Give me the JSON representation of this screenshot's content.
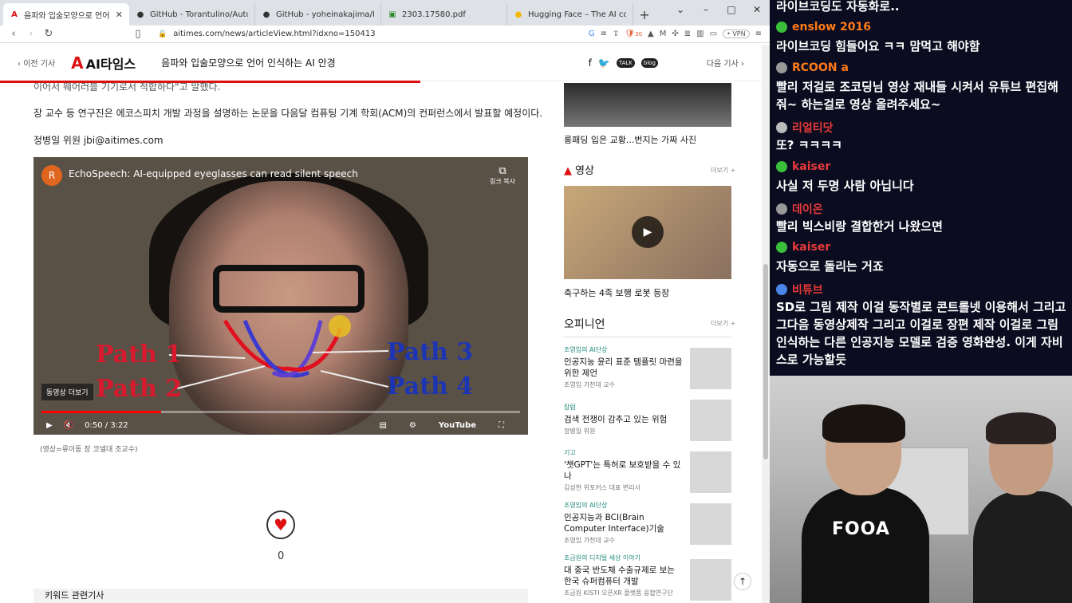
{
  "browser": {
    "tabs": [
      {
        "label": "음파와 입술모양으로 언어 인식하는 AI 안경",
        "icon": "aitimes-favicon",
        "active": true
      },
      {
        "label": "GitHub - Torantulino/Auto-GPT: An",
        "icon": "github-icon"
      },
      {
        "label": "GitHub - yoheinakajima/babyagi",
        "icon": "github-icon"
      },
      {
        "label": "2303.17580.pdf",
        "icon": "pdf-icon"
      },
      {
        "label": "Hugging Face – The AI communi",
        "icon": "huggingface-icon"
      }
    ],
    "url": "aitimes.com/news/articleView.html?idxno=150413",
    "vpn_label": "• VPN",
    "ext_badge": "30"
  },
  "site": {
    "prev_label": "이전 기사",
    "logo_text": "AI타임스",
    "headline": "음파와 입술모양으로 언어 인식하는 AI 안경",
    "next_label": "다음 기사",
    "social": {
      "talk": "TALK",
      "blog": "blog"
    }
  },
  "article": {
    "partial_line": "이어서 웨어러블 기기로서 적합하다\"고 말했다.",
    "paragraph": "장 교수 등 연구진은 에코스피치 개발 과정을 설명하는 논문을 다음달 컴퓨팅 기계 학회(ACM)의 컨퍼런스에서 발표할 예정이다.",
    "byline": "정병일 위원 jbi@aitimes.com",
    "caption": "(영상=류이동 장 코넬대 조교수)",
    "like_count": "0",
    "bottom_heading": "키워드 관련기사"
  },
  "video": {
    "avatar_letter": "R",
    "title": "EchoSpeech: AI-equipped eyeglasses can read silent speech",
    "copy_link": "링크 복사",
    "paths": [
      "Path 1",
      "Path 2",
      "Path 3",
      "Path 4"
    ],
    "more_videos": "동영상 더보기",
    "time": "0:50 / 3:22",
    "progress_fraction": 0.25,
    "brand": "YouTube"
  },
  "sidebar": {
    "top_title": "롱패딩 입은 교황...번지는 가짜 사진",
    "video_heading": "영상",
    "more": "더보기 +",
    "video_title": "축구하는 4족 보행 로봇 등장",
    "opinion_heading": "오피니언",
    "opinions": [
      {
        "category": "조영임의 AI단상",
        "title": "인공지능 윤리 표준 템플릿 마련을 위한 제언",
        "author": "조영임 가천대 교수"
      },
      {
        "category": "칼럼",
        "title": "검색 전쟁이 감추고 있는 위험",
        "author": "정병일 위원"
      },
      {
        "category": "기고",
        "title": "'챗GPT'는 특허로 보호받을 수 있나",
        "author": "김성현 위포커스 대표 변리사"
      },
      {
        "category": "조영임의 AI단상",
        "title": "인공지능과 BCI(Brain Computer Interface)기술",
        "author": "조영임 가천대 교수"
      },
      {
        "category": "조금원의 디지털 세상 이야기",
        "title": "대 중국 반도체 수출규제로 보는 한국 슈퍼컴퓨터 개발",
        "author": "조금원 KISTI 오픈XR 플랫폼 융합연구단"
      }
    ]
  },
  "chat": {
    "messages": [
      {
        "nick": "",
        "text": "라이브코딩도 자동화로.."
      },
      {
        "nick": "enslow 2016",
        "nick_color": "#ff7a1a",
        "icon_color": "#3bbf3b",
        "text": "라이브코딩 힘들어요 ㅋㅋ 맘먹고 해야함"
      },
      {
        "nick": "RCOON a",
        "nick_color": "#ff7a1a",
        "icon_color": "#999999",
        "text": "빨리 저걸로 조코딩님 영상 재내들 시켜서 유튜브 편집해줘~ 하는걸로 영상 올려주세요~"
      },
      {
        "nick": "리얼티닷",
        "nick_color": "#e83a3a",
        "icon_color": "#bbbbbb",
        "text": "또? ㅋㅋㅋㅋ"
      },
      {
        "nick": "kaiser",
        "nick_color": "#e83a3a",
        "icon_color": "#3bbf3b",
        "text": "사실 저 두명 사람 아닙니다"
      },
      {
        "nick": "데이온",
        "nick_color": "#e83a3a",
        "icon_color": "#999999",
        "text": "빨리 빅스비랑 결합한거 나왔으면"
      },
      {
        "nick": "kaiser",
        "nick_color": "#e83a3a",
        "icon_color": "#3bbf3b",
        "text": "자동으로 돌리는 거죠"
      },
      {
        "nick": "비튜브",
        "nick_color": "#e83a3a",
        "icon_color": "#4a86e8",
        "text": "SD로 그림 제작 이걸 동작별로 콘트롤넷 이용해서 그리고 그다음 동영상제작 그리고 이걸로 장편 제작 이걸로 그림 인식하는 다른 인공지능 모델로 검증 영화완성. 이게 자비스로 가능할듯"
      }
    ]
  },
  "webcam": {
    "shirt_text": "FOOA"
  }
}
